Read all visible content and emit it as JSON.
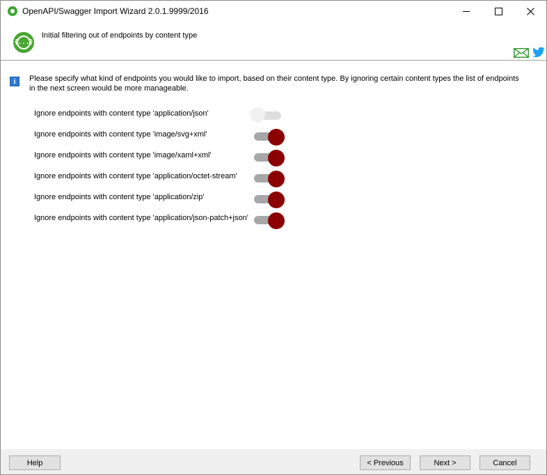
{
  "window": {
    "title": "OpenAPI/Swagger Import Wizard 2.0.1.9999/2016"
  },
  "header": {
    "title": "Initial filtering out of endpoints by content type",
    "logo_text": "{...}"
  },
  "info": {
    "text": "Please specify what kind of endpoints you would like to import, based on their content type. By ignoring certain content types the list of endpoints in the next screen would be more manageable."
  },
  "options": [
    {
      "label": "Ignore endpoints with content type 'application/json'",
      "enabled": false
    },
    {
      "label": "Ignore endpoints with content type 'image/svg+xml'",
      "enabled": true
    },
    {
      "label": "Ignore endpoints with content type 'image/xaml+xml'",
      "enabled": true
    },
    {
      "label": "Ignore endpoints with content type 'application/octet-stream'",
      "enabled": true
    },
    {
      "label": "Ignore endpoints with content type 'application/zip'",
      "enabled": true
    },
    {
      "label": "Ignore endpoints with content type 'application/json-patch+json'",
      "enabled": true
    }
  ],
  "buttons": {
    "help": "Help",
    "previous": "< Previous",
    "next": "Next >",
    "cancel": "Cancel"
  },
  "colors": {
    "toggle_on": "#8b0000",
    "logo_green": "#49a632",
    "twitter_blue": "#1da1f2",
    "mail_green": "#3a9a3a"
  },
  "icons": [
    "app-icon",
    "logo-icon",
    "mail-icon",
    "twitter-icon",
    "info-icon",
    "minimize-icon",
    "maximize-icon",
    "close-icon"
  ]
}
